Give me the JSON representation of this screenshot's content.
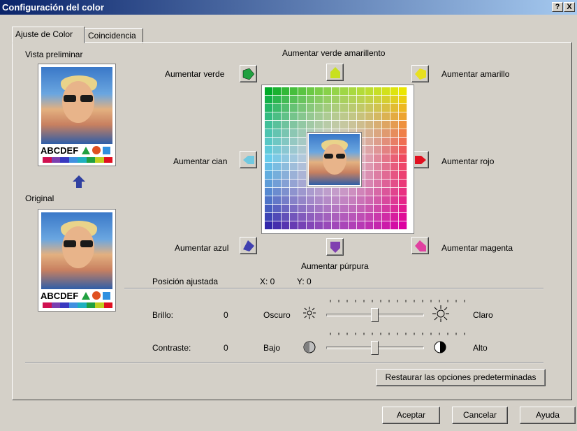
{
  "window": {
    "title": "Configuración del color",
    "help_label": "?",
    "close_label": "X"
  },
  "tabs": [
    {
      "label": "Ajuste de Color",
      "active": true
    },
    {
      "label": "Coincidencia",
      "active": false
    }
  ],
  "preview": {
    "preview_label": "Vista preliminar",
    "original_label": "Original",
    "sample_text": "ABCDEF",
    "swatch_colors": [
      "#d01050",
      "#7a3fb0",
      "#3838c0",
      "#4090e0",
      "#20b0c0",
      "#20a040",
      "#c0d020",
      "#e01020"
    ]
  },
  "color_buttons": {
    "green": "Aumentar verde",
    "green_yellow": "Aumentar verde amarillento",
    "yellow": "Aumentar amarillo",
    "cyan": "Aumentar cian",
    "red": "Aumentar rojo",
    "blue": "Aumentar azul",
    "purple": "Aumentar púrpura",
    "magenta": "Aumentar magenta"
  },
  "position": {
    "label": "Posición ajustada",
    "x_text": "X: 0",
    "y_text": "Y: 0"
  },
  "brightness": {
    "label": "Brillo:",
    "value": "0",
    "low_label": "Oscuro",
    "high_label": "Claro",
    "level": 0
  },
  "contrast": {
    "label": "Contraste:",
    "value": "0",
    "low_label": "Bajo",
    "high_label": "Alto",
    "level": 0
  },
  "reset_button": "Restaurar las opciones predeterminadas",
  "footer": {
    "ok": "Aceptar",
    "cancel": "Cancelar",
    "help": "Ayuda"
  }
}
